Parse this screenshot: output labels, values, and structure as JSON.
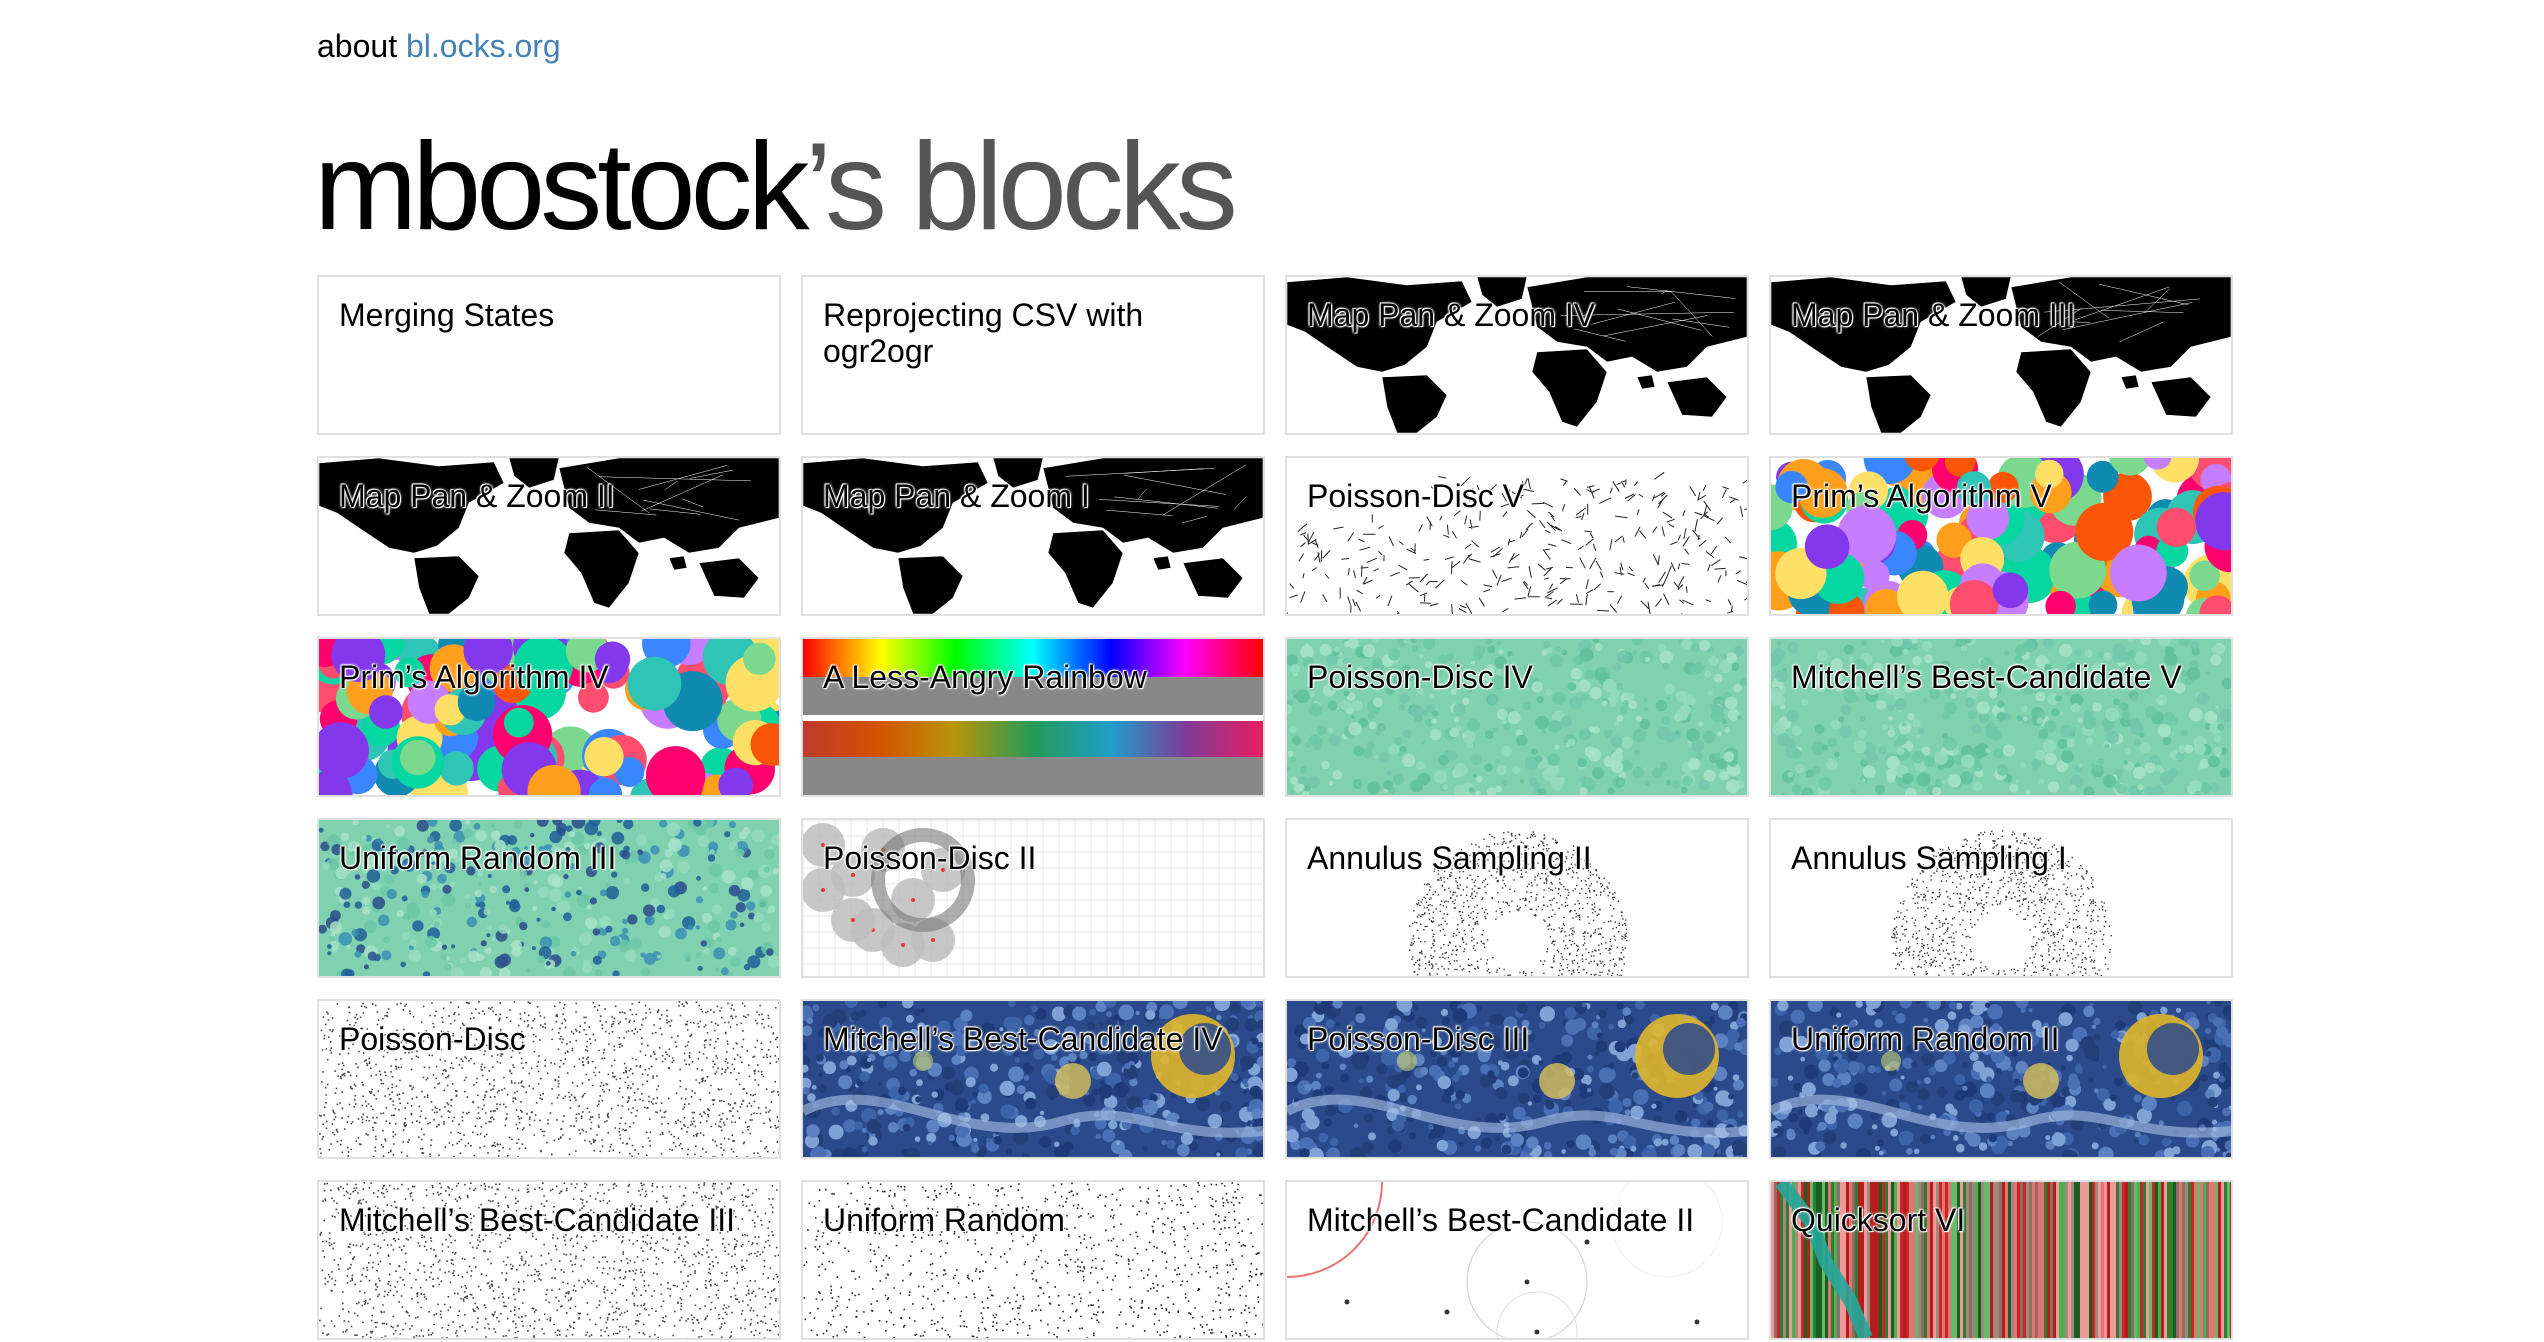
{
  "header": {
    "about_prefix": "about",
    "about_link": "bl.ocks.org",
    "owner": "mbostock",
    "suffix": "’s blocks"
  },
  "blocks": [
    {
      "title": "Merging States",
      "thumb": "blank"
    },
    {
      "title": "Reprojecting CSV with ogr2ogr",
      "thumb": "blank"
    },
    {
      "title": "Map Pan & Zoom IV",
      "thumb": "worldmap"
    },
    {
      "title": "Map Pan & Zoom III",
      "thumb": "worldmap"
    },
    {
      "title": "Map Pan & Zoom II",
      "thumb": "worldmap"
    },
    {
      "title": "Map Pan & Zoom I",
      "thumb": "worldmap"
    },
    {
      "title": "Poisson-Disc V",
      "thumb": "tree-lines"
    },
    {
      "title": "Prim’s Algorithm V",
      "thumb": "rainbow-regions"
    },
    {
      "title": "Prim’s Algorithm IV",
      "thumb": "rainbow-regions"
    },
    {
      "title": "A Less-Angry Rainbow",
      "thumb": "rainbow-bars"
    },
    {
      "title": "Poisson-Disc IV",
      "thumb": "teal-noise"
    },
    {
      "title": "Mitchell’s Best-Candidate V",
      "thumb": "teal-noise"
    },
    {
      "title": "Uniform Random III",
      "thumb": "teal-noise-dark"
    },
    {
      "title": "Poisson-Disc II",
      "thumb": "grid-circles"
    },
    {
      "title": "Annulus Sampling II",
      "thumb": "annulus"
    },
    {
      "title": "Annulus Sampling I",
      "thumb": "annulus"
    },
    {
      "title": "Poisson-Disc",
      "thumb": "dots"
    },
    {
      "title": "Mitchell’s Best-Candidate IV",
      "thumb": "starry-night"
    },
    {
      "title": "Poisson-Disc III",
      "thumb": "starry-night"
    },
    {
      "title": "Uniform Random II",
      "thumb": "starry-night"
    },
    {
      "title": "Mitchell’s Best-Candidate III",
      "thumb": "dots"
    },
    {
      "title": "Uniform Random",
      "thumb": "dots-sparse"
    },
    {
      "title": "Mitchell’s Best-Candidate II",
      "thumb": "circles"
    },
    {
      "title": "Quicksort VI",
      "thumb": "stripes"
    }
  ]
}
